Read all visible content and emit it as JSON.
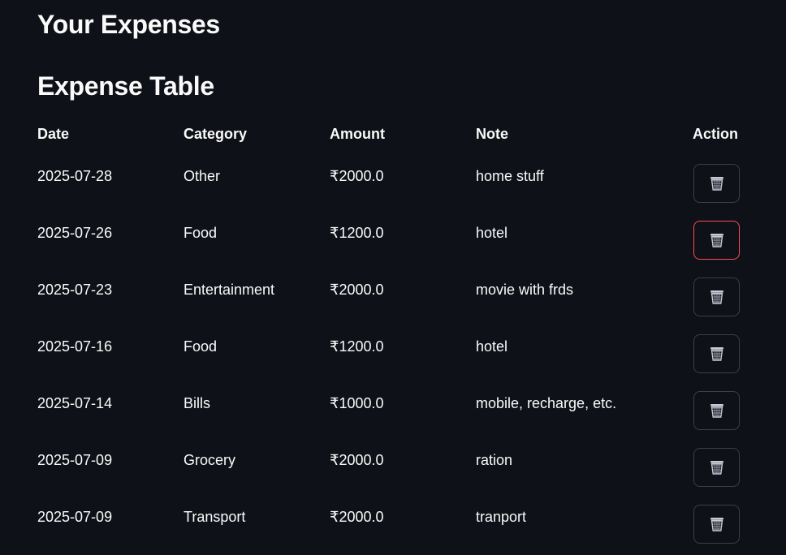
{
  "page": {
    "title": "Your Expenses",
    "section_title": "Expense Table"
  },
  "table": {
    "headers": {
      "date": "Date",
      "category": "Category",
      "amount": "Amount",
      "note": "Note",
      "action": "Action"
    },
    "rows": [
      {
        "date": "2025-07-28",
        "category": "Other",
        "amount": "₹2000.0",
        "note": "home stuff",
        "action_icon": "trash-icon",
        "highlighted": false
      },
      {
        "date": "2025-07-26",
        "category": "Food",
        "amount": "₹1200.0",
        "note": "hotel",
        "action_icon": "trash-icon",
        "highlighted": true
      },
      {
        "date": "2025-07-23",
        "category": "Entertainment",
        "amount": "₹2000.0",
        "note": "movie with frds",
        "action_icon": "trash-icon",
        "highlighted": false
      },
      {
        "date": "2025-07-16",
        "category": "Food",
        "amount": "₹1200.0",
        "note": "hotel",
        "action_icon": "trash-icon",
        "highlighted": false
      },
      {
        "date": "2025-07-14",
        "category": "Bills",
        "amount": "₹1000.0",
        "note": "mobile, recharge, etc.",
        "action_icon": "trash-icon",
        "highlighted": false
      },
      {
        "date": "2025-07-09",
        "category": "Grocery",
        "amount": "₹2000.0",
        "note": "ration",
        "action_icon": "trash-icon",
        "highlighted": false
      },
      {
        "date": "2025-07-09",
        "category": "Transport",
        "amount": "₹2000.0",
        "note": "tranport",
        "action_icon": "trash-icon",
        "highlighted": false
      }
    ]
  },
  "colors": {
    "background": "#0e1117",
    "text": "#fafafa",
    "button_border": "#3b3f4a",
    "button_border_hover": "#ff4b4b"
  }
}
